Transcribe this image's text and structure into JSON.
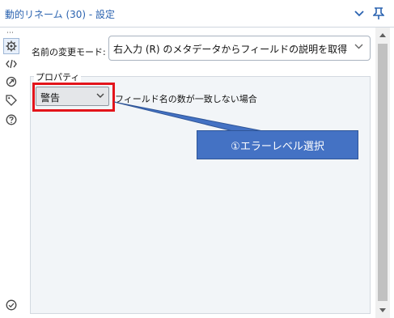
{
  "window": {
    "title": "動的リネーム (30) - 設定",
    "collapse_icon": "chevron-down-icon",
    "pin_icon": "pin-icon"
  },
  "sidebar": {
    "overflow": "⋯",
    "items": [
      {
        "icon": "gear-icon",
        "active": true
      },
      {
        "icon": "code-icon",
        "active": false
      },
      {
        "icon": "connection-icon",
        "active": false
      },
      {
        "icon": "tag-icon",
        "active": false
      },
      {
        "icon": "help-icon",
        "active": false
      }
    ],
    "bottom_icon": "check-circle-icon"
  },
  "form": {
    "mode_label": "名前の変更モード:",
    "mode_value": "右入力 (R) のメタデータからフィールドの説明を取得",
    "properties_legend": "プロパティ",
    "warning_select_value": "警告",
    "mismatch_label": "フィールド名の数が一致しない場合"
  },
  "annotation": {
    "callout_text": "①エラーレベル選択",
    "highlight_color": "#e3141b",
    "callout_color": "#4472c4"
  }
}
